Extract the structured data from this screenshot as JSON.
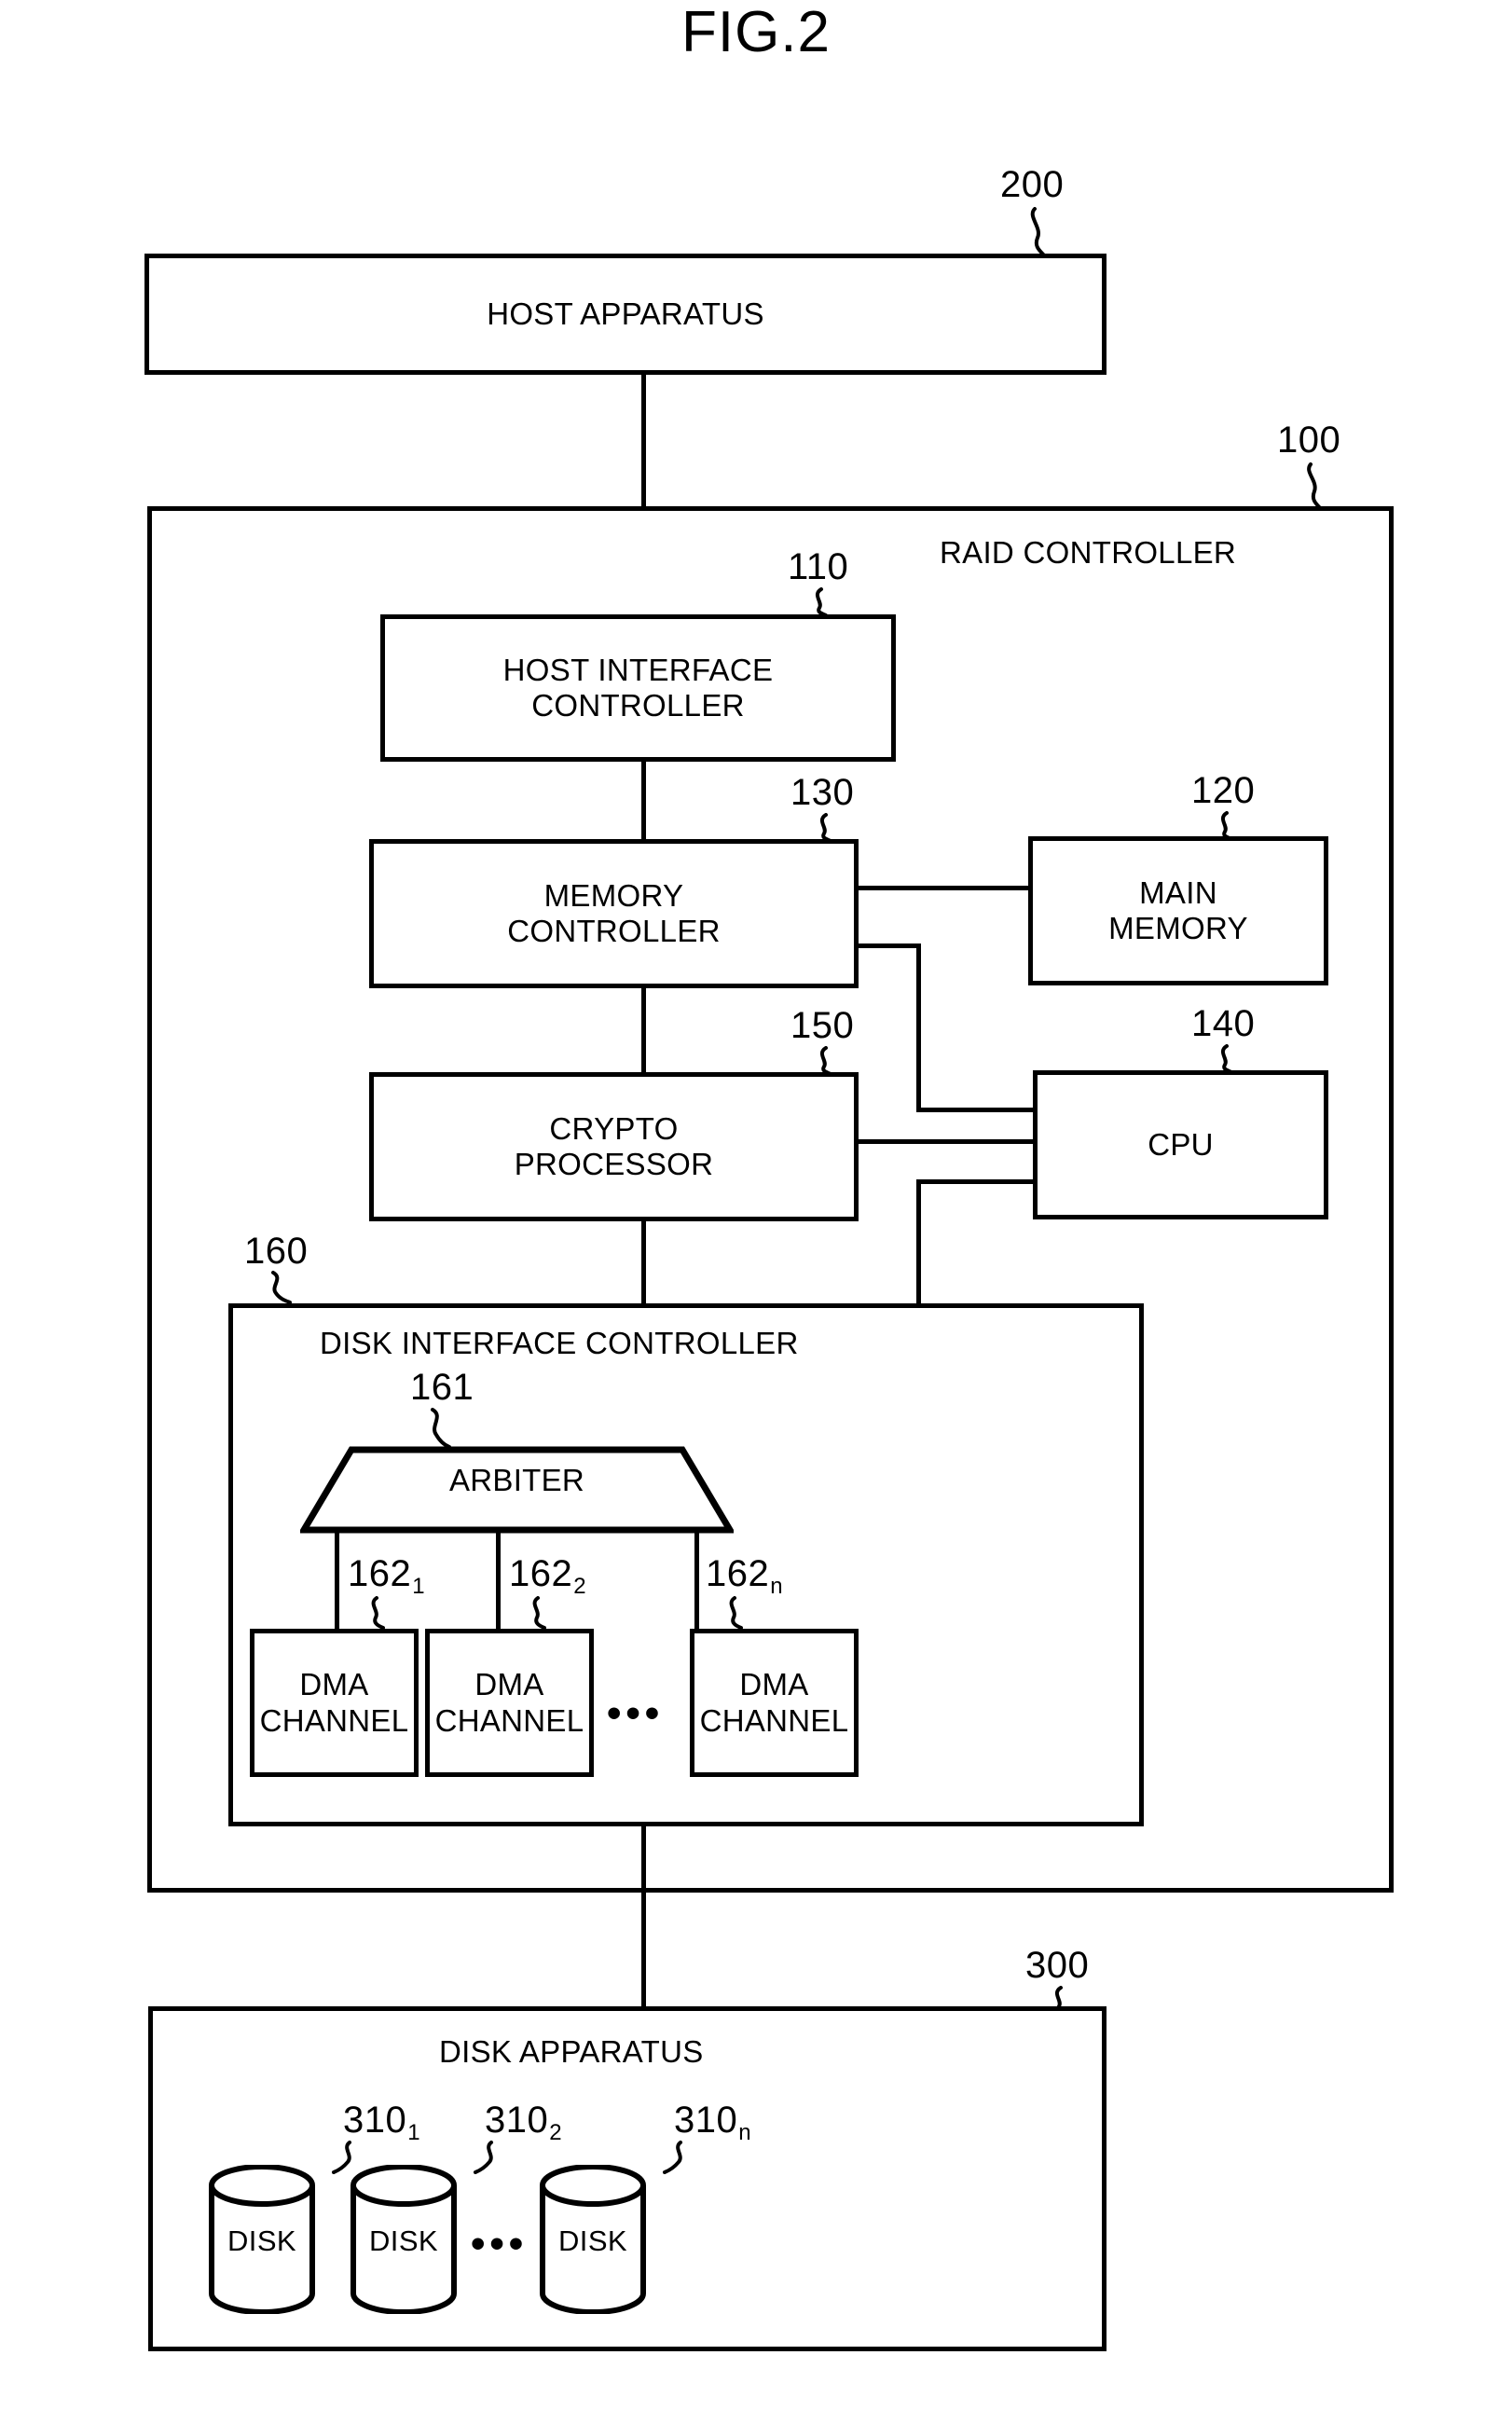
{
  "figure": {
    "title": "FIG.2"
  },
  "blocks": {
    "host_apparatus": {
      "label": "HOST APPARATUS",
      "ref": "200"
    },
    "raid_controller": {
      "label": "RAID CONTROLLER",
      "ref": "100"
    },
    "host_interface_controller": {
      "label": "HOST INTERFACE\nCONTROLLER",
      "ref": "110"
    },
    "memory_controller": {
      "label": "MEMORY\nCONTROLLER",
      "ref": "130"
    },
    "main_memory": {
      "label": "MAIN\nMEMORY",
      "ref": "120"
    },
    "crypto_processor": {
      "label": "CRYPTO\nPROCESSOR",
      "ref": "150"
    },
    "cpu": {
      "label": "CPU",
      "ref": "140"
    },
    "disk_interface_controller": {
      "label": "DISK INTERFACE CONTROLLER",
      "ref": "160"
    },
    "arbiter": {
      "label": "ARBITER",
      "ref": "161"
    },
    "disk_apparatus": {
      "label": "DISK APPARATUS",
      "ref": "300"
    }
  },
  "dma_channels": [
    {
      "label": "DMA\nCHANNEL",
      "ref": "162",
      "sub": "1"
    },
    {
      "label": "DMA\nCHANNEL",
      "ref": "162",
      "sub": "2"
    },
    {
      "label": "DMA\nCHANNEL",
      "ref": "162",
      "sub": "n"
    }
  ],
  "dma_ellipsis": "•••",
  "disks": [
    {
      "label": "DISK",
      "ref": "310",
      "sub": "1"
    },
    {
      "label": "DISK",
      "ref": "310",
      "sub": "2"
    },
    {
      "label": "DISK",
      "ref": "310",
      "sub": "n"
    }
  ],
  "disk_ellipsis": "•••",
  "colors": {
    "ink": "#000000",
    "paper": "#ffffff"
  }
}
